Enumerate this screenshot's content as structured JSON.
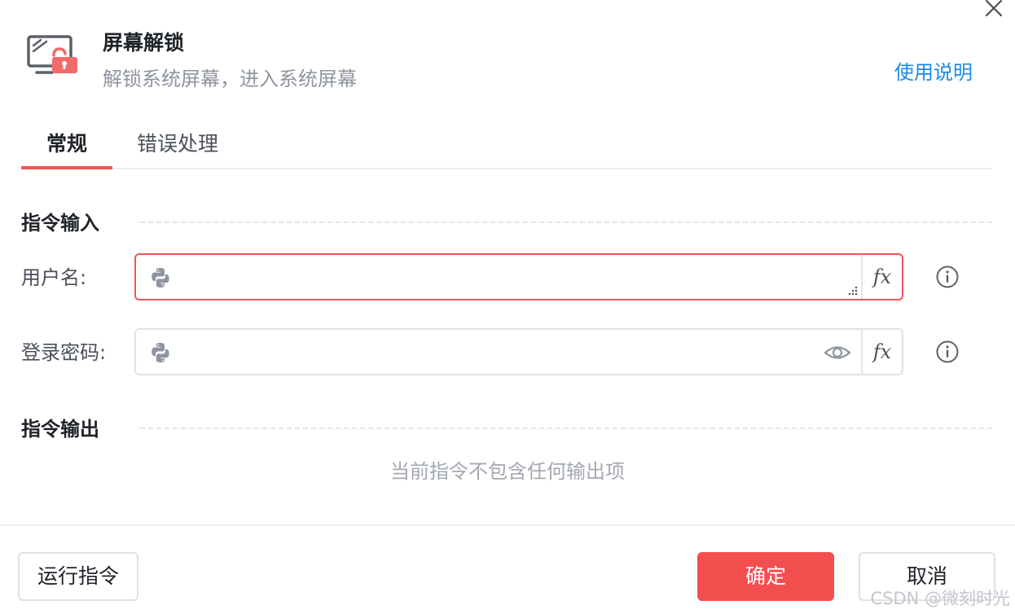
{
  "dialog": {
    "title": "屏幕解锁",
    "subtitle": "解锁系统屏幕，进入系统屏幕",
    "help_link": "使用说明"
  },
  "tabs": [
    {
      "label": "常规",
      "active": true
    },
    {
      "label": "错误处理",
      "active": false
    }
  ],
  "input_section": {
    "title": "指令输入",
    "fields": [
      {
        "label": "用户名:",
        "value": "",
        "state": "error",
        "fx_label": "fx"
      },
      {
        "label": "登录密码:",
        "value": "",
        "fx_label": "fx"
      }
    ]
  },
  "output_section": {
    "title": "指令输出",
    "empty_text": "当前指令不包含任何输出项"
  },
  "footer": {
    "run_label": "运行指令",
    "ok_label": "确定",
    "cancel_label": "取消"
  },
  "watermark": "CSDN @微刻时光",
  "colors": {
    "accent_red": "#f44f4f",
    "link_blue": "#1e88e5",
    "error_border": "#f25452"
  },
  "icons": {
    "header": "monitor-unlock-icon",
    "field_prefix": "python-icon",
    "password_toggle": "eye-icon",
    "help": "info-icon",
    "close": "close-icon"
  }
}
